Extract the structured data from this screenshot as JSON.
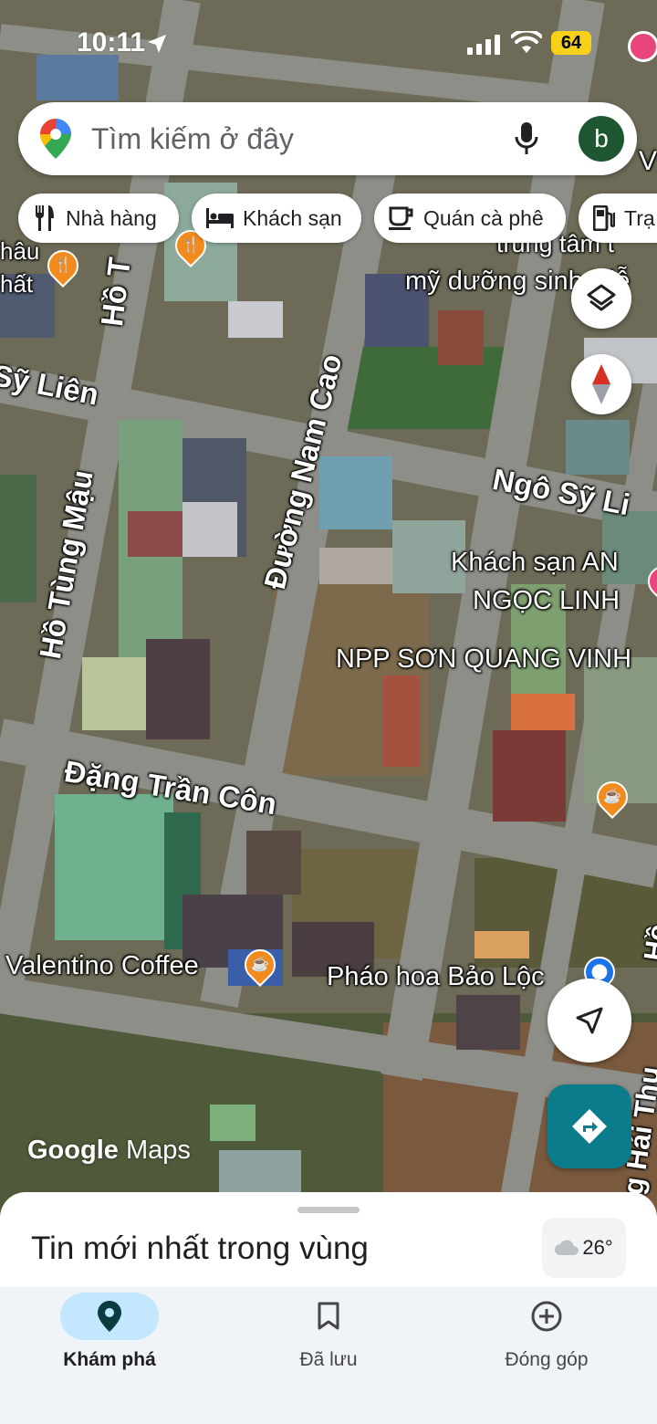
{
  "status_bar": {
    "time": "10:11",
    "battery": "64"
  },
  "search": {
    "placeholder": "Tìm kiếm ở đây",
    "avatar_letter": "b"
  },
  "chips": [
    {
      "label": "Nhà hàng",
      "icon": "restaurant-icon"
    },
    {
      "label": "Khách sạn",
      "icon": "hotel-icon"
    },
    {
      "label": "Quán cà phê",
      "icon": "coffee-icon"
    },
    {
      "label": "Trạ",
      "icon": "gas-station-icon"
    }
  ],
  "map": {
    "streets": {
      "ho_tung_mau_top": "Hồ T",
      "ho_tung_mau": "Hồ Tùng Mậu",
      "ngo_sy_lien_left": "Sỹ Liên",
      "ngo_sy_lien_right": "Ngô Sỹ Li",
      "nam_cao": "Đường Nam Cao",
      "dang_tran_con": "Đặng Trần Côn",
      "right_vertical": "g Hải Thu",
      "right_vertical2": "Hồ"
    },
    "pois": {
      "left_top_1": "hâu",
      "left_top_2": "hất",
      "top_right_1": "trung tâm t",
      "top_right_2": "mỹ dưỡng sinh Diễ",
      "top_right_corner": "V",
      "hotel_1": "Khách sạn AN",
      "hotel_2": "NGỌC LINH",
      "npp": "NPP SƠN QUANG VINH",
      "valentino": "Valentino Coffee",
      "phao_hoa": "Pháo hoa Bảo Lộc"
    },
    "watermark_google": "Google",
    "watermark_maps": "Maps"
  },
  "bottom_sheet": {
    "title": "Tin mới nhất trong vùng",
    "temperature": "26°"
  },
  "nav": [
    {
      "label": "Khám phá",
      "icon": "explore-pin-icon",
      "active": true
    },
    {
      "label": "Đã lưu",
      "icon": "bookmark-icon",
      "active": false
    },
    {
      "label": "Đóng góp",
      "icon": "add-circle-icon",
      "active": false
    }
  ],
  "colors": {
    "accent_teal": "#0b7c8c",
    "active_nav": "#c2e7ff",
    "poi_orange": "#f28b1d",
    "compass_red": "#d93025"
  }
}
